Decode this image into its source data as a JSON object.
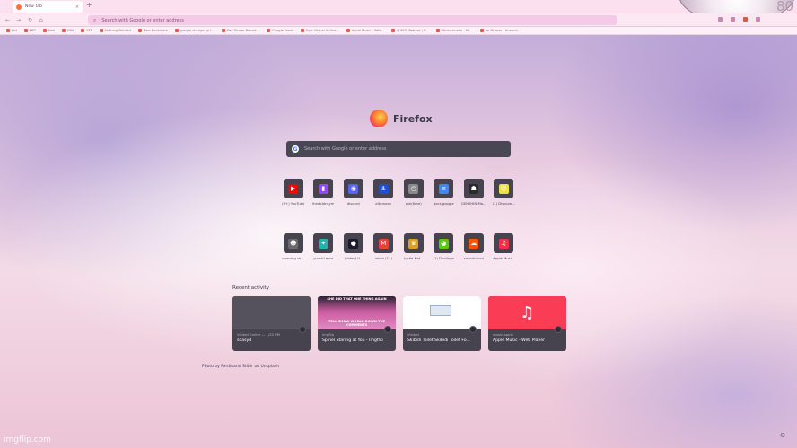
{
  "browser": {
    "tab_title": "New Tab",
    "tab_close": "×",
    "new_tab": "+",
    "corner_number": "80",
    "nav_icons": [
      "←",
      "→",
      "↻",
      "⌂"
    ],
    "url_placeholder": "Search with Google or enter address",
    "bookmarks": [
      "Kid",
      "PBD",
      "Nah",
      "ERA",
      "STE",
      "Nothing Painted",
      "New Bookmark",
      "google change up t...",
      "Pay Dinner Report...",
      "Google Feeds",
      "Epic Virtual Airline...",
      "Apple Music - Web...",
      "(1993) Retreat | If...",
      "Ultraschnelle - 90...",
      "Im Mumas - Aneurol..."
    ]
  },
  "logo_text": "Firefox",
  "search_placeholder": "Search with Google or enter address",
  "search_icon_letter": "G",
  "shortcuts": [
    {
      "label": "(9+) YouTube",
      "icon": "youtube-icon",
      "glyph": "▶",
      "color": "#ff0000"
    },
    {
      "label": "lhedoldnsym",
      "icon": "twitch-icon",
      "glyph": "▮",
      "color": "#9146ff"
    },
    {
      "label": "discord",
      "icon": "discord-icon",
      "glyph": "◉",
      "color": "#5865f2"
    },
    {
      "label": "altamoon",
      "icon": "anchor-icon",
      "glyph": "⚓",
      "color": "#1f4fd0"
    },
    {
      "label": "ask(time)",
      "icon": "clock-icon",
      "glyph": "◷",
      "color": "#8a8a8a"
    },
    {
      "label": "docs.google",
      "icon": "docs-icon",
      "glyph": "≡",
      "color": "#4285f4"
    },
    {
      "label": "GENSHIN Ma...",
      "icon": "helmet-icon",
      "glyph": "☗",
      "color": "#2b2b2b"
    },
    {
      "label": "(1) Discove...",
      "icon": "smiley-icon",
      "glyph": "☺",
      "color": "#f0e040"
    },
    {
      "label": "opening ch...",
      "icon": "face-icon",
      "glyph": "☻",
      "color": "#6b6b6b"
    },
    {
      "label": "yuzuki ema",
      "icon": "star-puzzle-icon",
      "glyph": "✦",
      "color": "#1fb5a8"
    },
    {
      "label": "(Video) V...",
      "icon": "dark-circle-icon",
      "glyph": "●",
      "color": "#1a1a2e"
    },
    {
      "label": "Inbox (17)",
      "icon": "gmail-icon",
      "glyph": "M",
      "color": "#ea4335"
    },
    {
      "label": "Lycée Nat...",
      "icon": "trophy-icon",
      "glyph": "♛",
      "color": "#d9a31f"
    },
    {
      "label": "(1) Duolingo",
      "icon": "duolingo-icon",
      "glyph": "◕",
      "color": "#58cc02"
    },
    {
      "label": "soundcloud",
      "icon": "soundcloud-icon",
      "glyph": "☁",
      "color": "#ff5500"
    },
    {
      "label": "Apple Musi...",
      "icon": "apple-music-icon",
      "glyph": "♫",
      "color": "#fa2d48"
    }
  ],
  "recent_activity": {
    "title": "Recent activity",
    "cards": [
      {
        "source": "Visited Earlier — 1/22 PM",
        "title": "sdasyd",
        "thumb": "empty"
      },
      {
        "source": "imgflip",
        "title": "Spinel Staring at You - Imgflip",
        "thumb": "meme",
        "caption_top": "SHE DID THAT ONE THING AGAIN",
        "caption_bottom": "TELL SHOW WORLD DOWN THE COMMENTS"
      },
      {
        "source": "Visited",
        "title": "Skibidi Toilet Skibidi Toilet Fo...",
        "thumb": "site"
      },
      {
        "source": "music.apple",
        "title": "Apple Music - Web Player",
        "thumb": "music",
        "glyph": "♫"
      }
    ]
  },
  "photo_credit": "Photo by Ferdinand Stöhr on Unsplash",
  "watermark": "imgflip.com",
  "settings_glyph": "⚙"
}
